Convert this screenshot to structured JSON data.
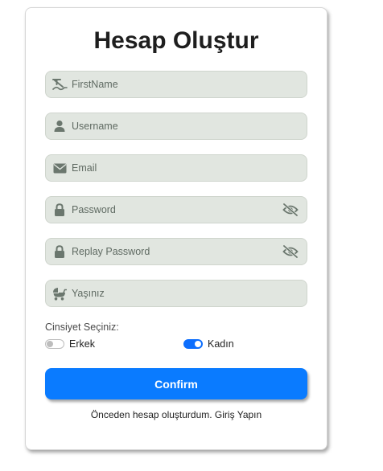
{
  "form": {
    "title": "Hesap Oluştur",
    "fields": {
      "firstname": {
        "placeholder": "FirstName",
        "icon": "signature-icon"
      },
      "username": {
        "placeholder": "Username",
        "icon": "user-icon"
      },
      "email": {
        "placeholder": "Email",
        "icon": "envelope-icon"
      },
      "password": {
        "placeholder": "Password",
        "icon": "lock-icon",
        "toggle_icon": "eye-slash-icon"
      },
      "replay_password": {
        "placeholder": "Replay Password",
        "icon": "lock-icon",
        "toggle_icon": "eye-slash-icon"
      },
      "age": {
        "placeholder": "Yaşınız",
        "icon": "baby-carriage-icon"
      }
    },
    "gender": {
      "label": "Cinsiyet Seçiniz:",
      "options": [
        {
          "label": "Erkek",
          "selected": false
        },
        {
          "label": "Kadın",
          "selected": true
        }
      ]
    },
    "confirm_label": "Confirm",
    "login_link": "Önceden hesap oluşturdum. Giriş Yapın"
  },
  "colors": {
    "accent": "#0a7bff",
    "field_bg": "#e1e6e0",
    "icon": "#6b776e"
  }
}
